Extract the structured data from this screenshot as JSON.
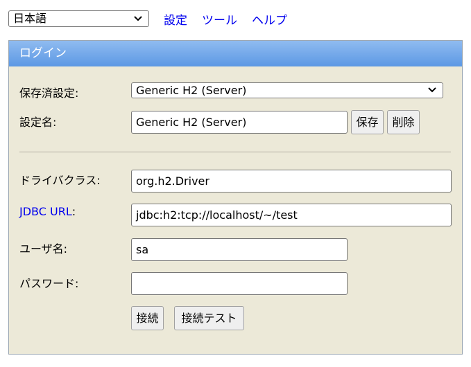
{
  "topbar": {
    "language": "日本語",
    "links": [
      "設定",
      "ツール",
      "ヘルプ"
    ]
  },
  "panel": {
    "title": "ログイン",
    "saved_settings_label": "保存済設定:",
    "saved_settings_value": "Generic H2 (Server)",
    "setting_name_label": "設定名:",
    "setting_name_value": "Generic H2 (Server)",
    "save_button": "保存",
    "delete_button": "削除",
    "driver_class_label": "ドライバクラス:",
    "driver_class_value": "org.h2.Driver",
    "jdbc_url_label": "JDBC URL",
    "jdbc_url_colon": ":",
    "jdbc_url_value": "jdbc:h2:tcp://localhost/~/test",
    "username_label": "ユーザ名:",
    "username_value": "sa",
    "password_label": "パスワード:",
    "password_value": "",
    "connect_button": "接続",
    "test_connection_button": "接続テスト"
  },
  "icons": {
    "dropdown": "chevron-down-icon"
  }
}
